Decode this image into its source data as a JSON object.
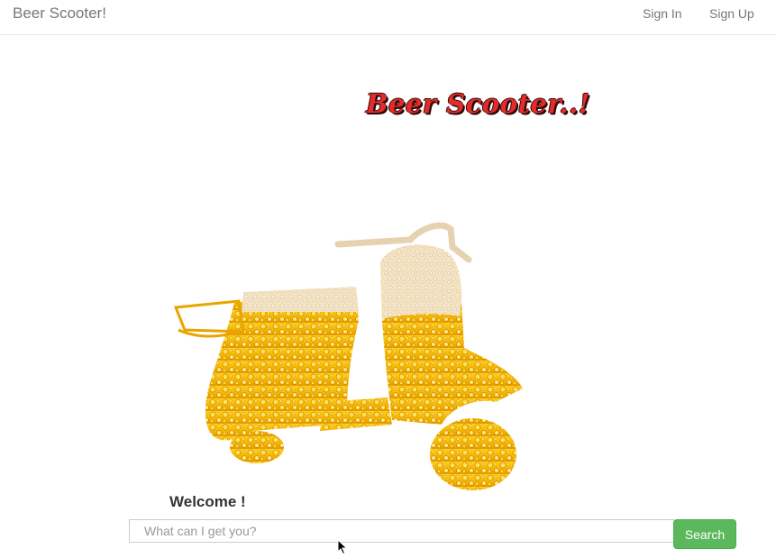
{
  "navbar": {
    "brand": "Beer Scooter!",
    "sign_in": "Sign In",
    "sign_up": "Sign Up"
  },
  "hero": {
    "logo_text": "Beer Scooter..!",
    "logo_color": "#e32b2b",
    "image_icon": "beer-scooter-illustration"
  },
  "welcome": {
    "text": "Welcome !"
  },
  "search": {
    "placeholder": "What can I get you?",
    "value": "",
    "button_label": "Search",
    "button_color": "#5cb85c"
  }
}
